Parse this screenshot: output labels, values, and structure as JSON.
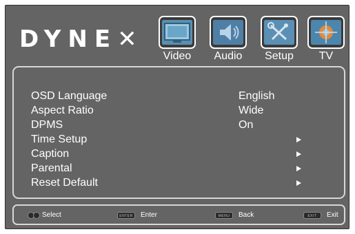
{
  "brand": {
    "logo_text": "DYNE",
    "logo_x": "✕"
  },
  "tabs": [
    {
      "label": "Video",
      "icon": "video-tv-icon"
    },
    {
      "label": "Audio",
      "icon": "audio-speaker-icon"
    },
    {
      "label": "Setup",
      "icon": "setup-tools-icon"
    },
    {
      "label": "TV",
      "icon": "tv-antenna-icon"
    }
  ],
  "menu": [
    {
      "label": "OSD Language",
      "value": "English"
    },
    {
      "label": "Aspect Ratio",
      "value": "Wide"
    },
    {
      "label": "DPMS",
      "value": "On"
    },
    {
      "label": "Time Setup",
      "submenu": true
    },
    {
      "label": "Caption",
      "submenu": true
    },
    {
      "label": "Parental",
      "submenu": true
    },
    {
      "label": "Reset Default",
      "submenu": true
    }
  ],
  "footer": {
    "select": {
      "text": "Select"
    },
    "enter": {
      "key": "ENTER",
      "text": "Enter"
    },
    "back": {
      "key": "MENU",
      "text": "Back"
    },
    "exit": {
      "key": "EXIT",
      "text": "Exit"
    }
  },
  "colors": {
    "background": "#646464",
    "text": "#ffffff",
    "border": "#d8d8d8"
  }
}
